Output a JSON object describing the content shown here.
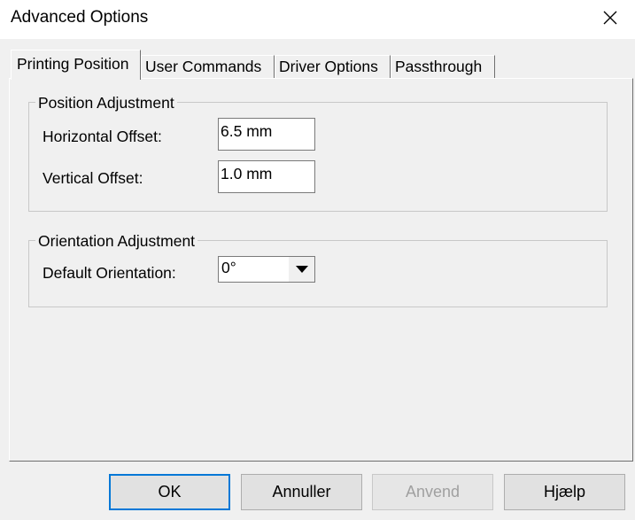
{
  "window": {
    "title": "Advanced Options",
    "close_icon": "close-icon"
  },
  "tabs": [
    {
      "label": "Printing Position",
      "active": true
    },
    {
      "label": "User Commands",
      "active": false
    },
    {
      "label": "Driver Options",
      "active": false
    },
    {
      "label": "Passthrough",
      "active": false
    }
  ],
  "position_group": {
    "title": "Position Adjustment",
    "horizontal_label": "Horizontal Offset:",
    "horizontal_value": "6.5 mm",
    "vertical_label": "Vertical Offset:",
    "vertical_value": "1.0 mm"
  },
  "orientation_group": {
    "title": "Orientation Adjustment",
    "default_label": "Default Orientation:",
    "default_value": "0°",
    "dropdown_icon": "chevron-down-icon"
  },
  "buttons": {
    "ok": "OK",
    "cancel": "Annuller",
    "apply": "Anvend",
    "help": "Hjælp"
  },
  "colors": {
    "default_button_border": "#0078d7",
    "disabled_text": "#a0a0a0"
  }
}
